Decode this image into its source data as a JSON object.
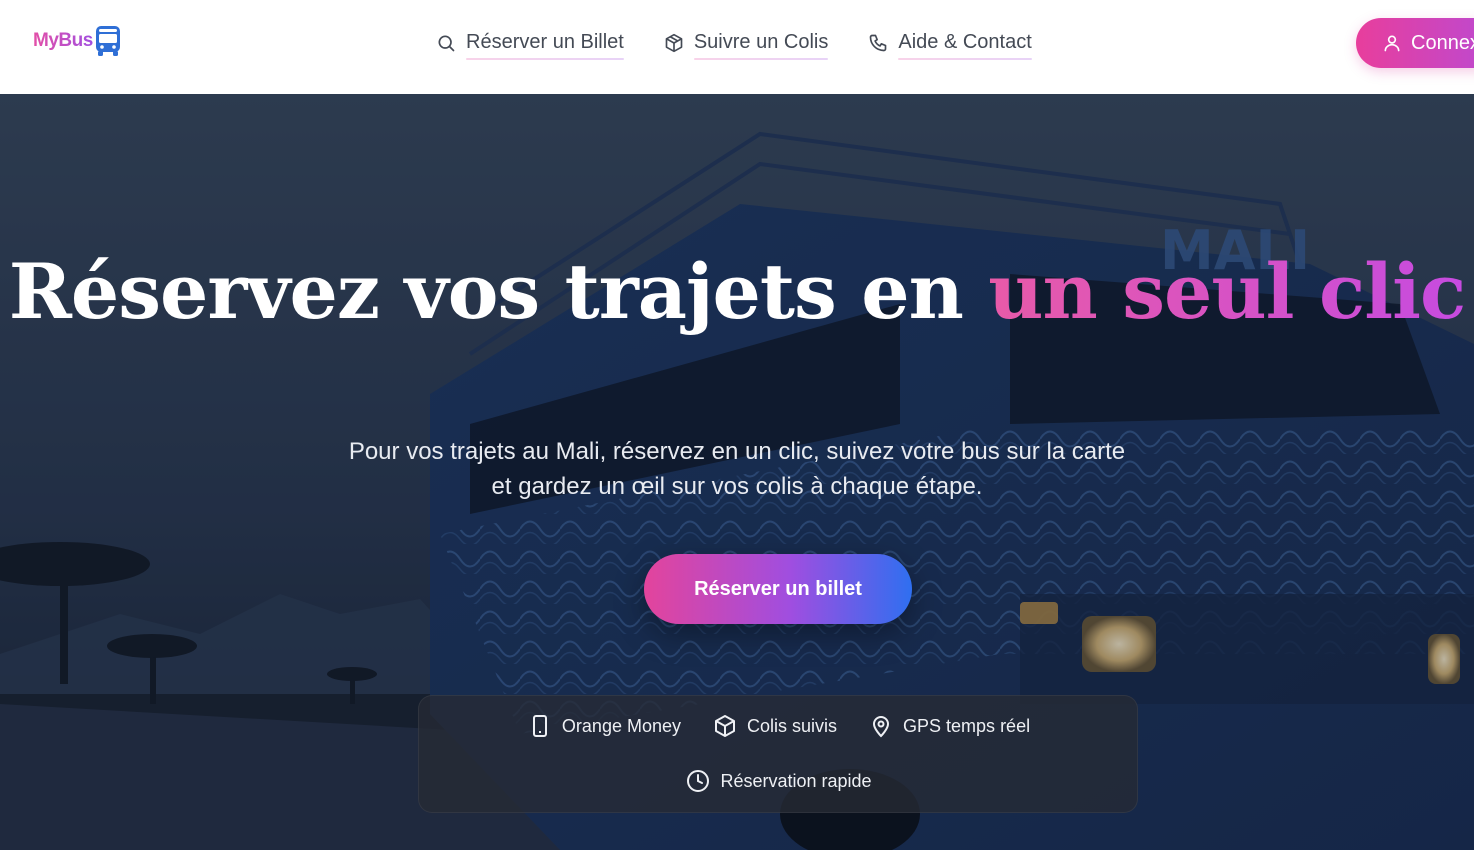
{
  "brand": {
    "name": "MyBus",
    "logo_icon": "bus-icon"
  },
  "nav": {
    "items": [
      {
        "label": "Réserver un Billet",
        "icon": "search-icon"
      },
      {
        "label": "Suivre un Colis",
        "icon": "package-icon"
      },
      {
        "label": "Aide & Contact",
        "icon": "phone-icon"
      }
    ],
    "login_label": "Connexion",
    "login_icon": "user-icon"
  },
  "hero": {
    "title_main": "Réservez vos trajets en ",
    "title_accent": "un seul clic",
    "subtitle": "Pour vos trajets au Mali, réservez en un clic, suivez votre bus sur la carte et gardez un œil sur vos colis à chaque étape.",
    "cta_label": "Réserver un billet",
    "bus_painted_text": "MALI"
  },
  "features": [
    {
      "label": "Orange Money",
      "icon": "smartphone-icon"
    },
    {
      "label": "Colis suivis",
      "icon": "package-icon"
    },
    {
      "label": "GPS temps réel",
      "icon": "map-pin-icon"
    },
    {
      "label": "Réservation rapide",
      "icon": "clock-icon"
    }
  ],
  "colors": {
    "accent_pink": "#e83e9c",
    "accent_purple": "#b64bd9",
    "accent_blue": "#2f6ff0",
    "nav_text": "#444a55"
  }
}
